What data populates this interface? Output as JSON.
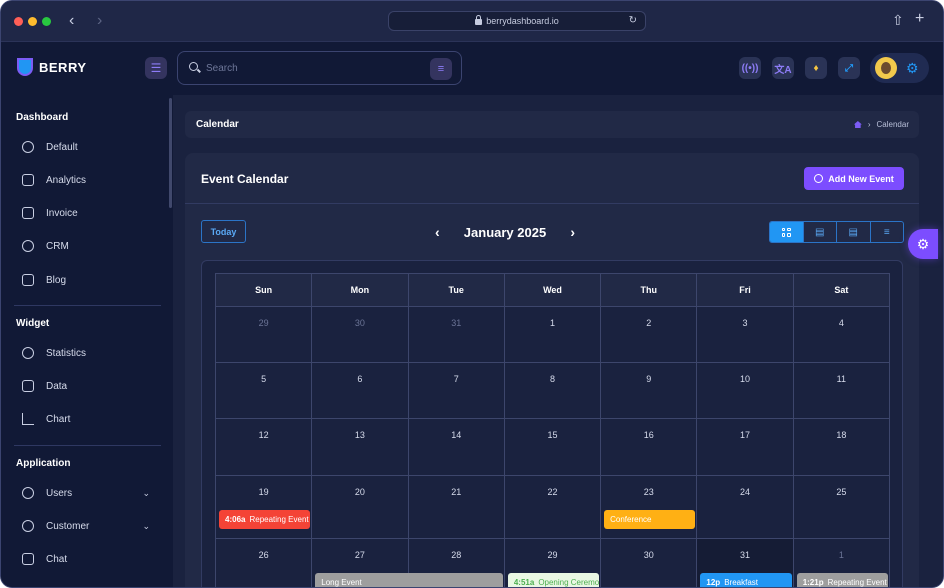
{
  "browser": {
    "url": "berrydashboard.io"
  },
  "header": {
    "brand": "BERRY",
    "search_placeholder": "Search"
  },
  "sidebar": {
    "sections": [
      {
        "title": "Dashboard",
        "items": [
          "Default",
          "Analytics",
          "Invoice",
          "CRM",
          "Blog"
        ]
      },
      {
        "title": "Widget",
        "items": [
          "Statistics",
          "Data",
          "Chart"
        ]
      },
      {
        "title": "Application",
        "items": [
          "Users",
          "Customer",
          "Chat"
        ]
      }
    ]
  },
  "breadcrumb": {
    "title": "Calendar",
    "current": "Calendar"
  },
  "calendar": {
    "card_title": "Event Calendar",
    "add_button": "Add New Event",
    "today_button": "Today",
    "month_title": "January 2025",
    "weekdays": [
      "Sun",
      "Mon",
      "Tue",
      "Wed",
      "Thu",
      "Fri",
      "Sat"
    ],
    "weeks": [
      [
        "29",
        "30",
        "31",
        "1",
        "2",
        "3",
        "4"
      ],
      [
        "5",
        "6",
        "7",
        "8",
        "9",
        "10",
        "11"
      ],
      [
        "12",
        "13",
        "14",
        "15",
        "16",
        "17",
        "18"
      ],
      [
        "19",
        "20",
        "21",
        "22",
        "23",
        "24",
        "25"
      ],
      [
        "26",
        "27",
        "28",
        "29",
        "30",
        "31",
        "1"
      ]
    ],
    "events": [
      {
        "time": "4:06a",
        "title": "Repeating Event",
        "color": "#f44336"
      },
      {
        "time": "",
        "title": "Conference",
        "color": "#ffb014"
      },
      {
        "time": "",
        "title": "Long Event",
        "color": "#9e9e9e"
      },
      {
        "time": "4:51a",
        "title": "Opening Ceremony",
        "color": "#e9f7e3"
      },
      {
        "time": "12p",
        "title": "Breakfast",
        "color": "#2196f3"
      },
      {
        "time": "1:21p",
        "title": "Repeating Event",
        "color": "#9e9e9e"
      }
    ]
  },
  "colors": {
    "accent": "#7c4dff",
    "primary": "#2196f3",
    "background": "#1a223f",
    "paper": "#212946",
    "sidebar": "#111936"
  }
}
